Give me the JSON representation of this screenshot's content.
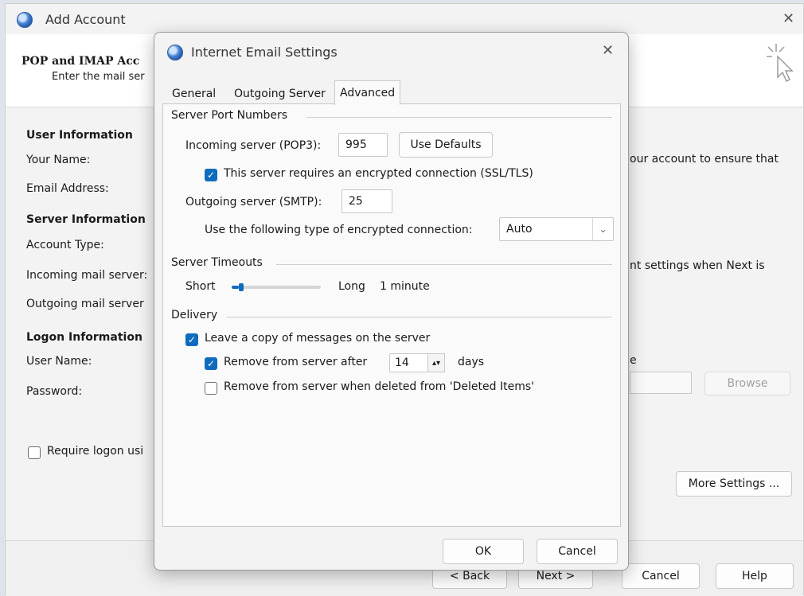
{
  "back_window": {
    "title": "Add Account",
    "close_glyph": "✕",
    "header_title": "POP and IMAP Acc",
    "header_subtitle": "Enter the mail ser",
    "user_info_heading": "User Information",
    "your_name_label": "Your Name:",
    "email_label": "Email Address:",
    "server_info_heading": "Server Information",
    "account_type_label": "Account Type:",
    "incoming_label": "Incoming mail server:",
    "outgoing_label": "Outgoing mail server",
    "logon_info_heading": "Logon Information",
    "user_name_label": "User Name:",
    "password_label": "Password:",
    "require_logon_label": "Require logon usi",
    "right_text_1": "our account to ensure that",
    "right_text_2": "nt settings when Next is",
    "right_text_3": "e",
    "browse_label": "Browse",
    "more_settings_label": "More Settings ...",
    "back_label": "< Back",
    "next_label": "Next >",
    "cancel_label": "Cancel",
    "help_label": "Help"
  },
  "dialog": {
    "title": "Internet Email Settings",
    "close_glyph": "✕",
    "tabs": [
      "General",
      "Outgoing Server",
      "Advanced"
    ],
    "active_tab": "Advanced",
    "server_port_numbers": {
      "heading": "Server Port Numbers",
      "incoming_label": "Incoming server (POP3):",
      "incoming_port": "995",
      "use_defaults_label": "Use Defaults",
      "ssl_checkbox_label": "This server requires an encrypted connection (SSL/TLS)",
      "ssl_checked": true,
      "outgoing_label": "Outgoing server (SMTP):",
      "outgoing_port": "25",
      "encryption_label": "Use the following type of encrypted connection:",
      "encryption_value": "Auto"
    },
    "server_timeouts": {
      "heading": "Server Timeouts",
      "short_label": "Short",
      "long_label": "Long",
      "timeout_value": "1 minute",
      "slider_fraction": 0.08
    },
    "delivery": {
      "heading": "Delivery",
      "leave_copy_label": "Leave a copy of messages on the server",
      "leave_copy_checked": true,
      "remove_after_label": "Remove from server after",
      "remove_after_checked": true,
      "remove_after_days": "14",
      "days_label": "days",
      "remove_deleted_label": "Remove from server when deleted from 'Deleted Items'",
      "remove_deleted_checked": false
    },
    "ok_label": "OK",
    "cancel_label": "Cancel"
  },
  "colors": {
    "accent": "#0f6cbd",
    "window_bg": "#f3f3f3"
  }
}
